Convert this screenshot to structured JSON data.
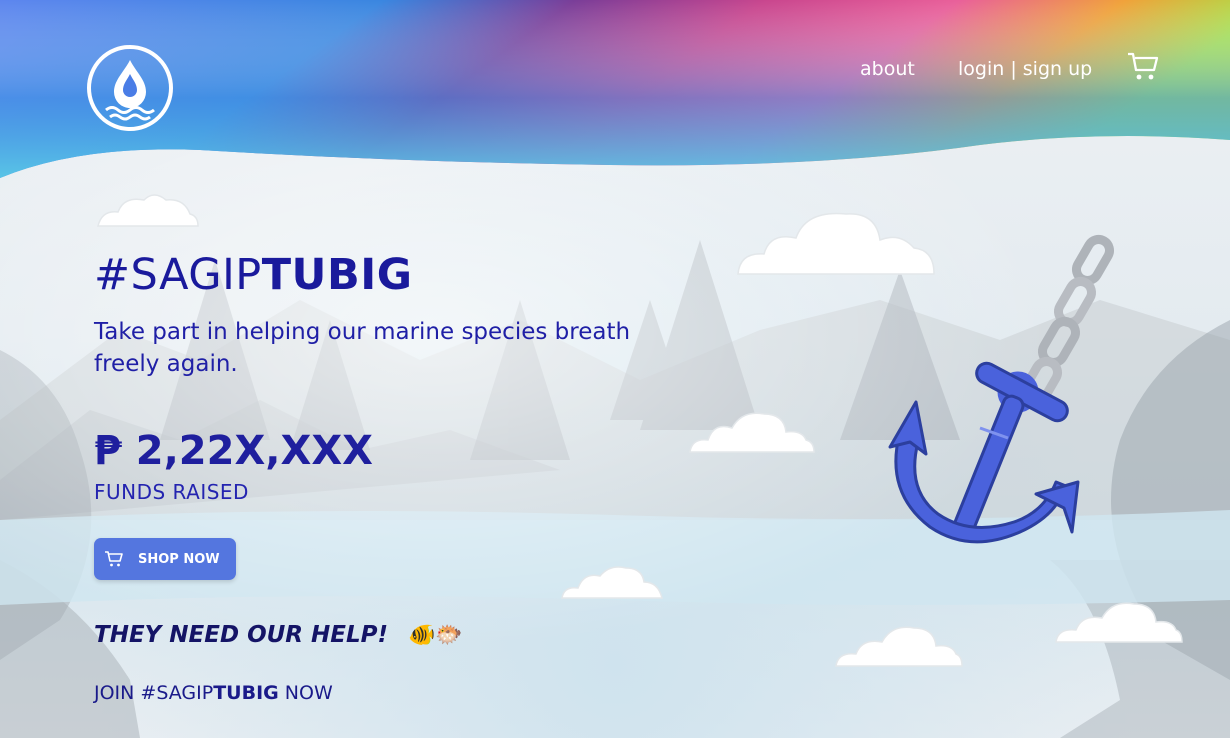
{
  "nav": {
    "about_label": "about",
    "login_label": "login | sign up"
  },
  "hero": {
    "title_prefix": "#SAGIP",
    "title_bold": "TUBIG",
    "subtitle": "Take part in helping our marine species breath freely again.",
    "funds_amount": "₱ 2,22X,XXX",
    "funds_label": "FUNDS RAISED",
    "shop_button_label": "SHOP NOW",
    "help_text": "THEY NEED OUR HELP!",
    "help_emoji": "🐠🐡",
    "join_prefix": "JOIN #SAGIP",
    "join_bold": "TUBIG",
    "join_suffix": " NOW"
  },
  "icons": {
    "logo": "water-drop-logo-icon",
    "cart": "shopping-cart-icon",
    "anchor": "anchor-icon"
  },
  "colors": {
    "primary_text": "#1a1a9c",
    "button": "#5476df",
    "anchor": "#4a62dc",
    "header_gradient": [
      "#4a7de6",
      "#7a3a9a",
      "#e85aa0",
      "#f0a030",
      "#a6e04a"
    ]
  }
}
